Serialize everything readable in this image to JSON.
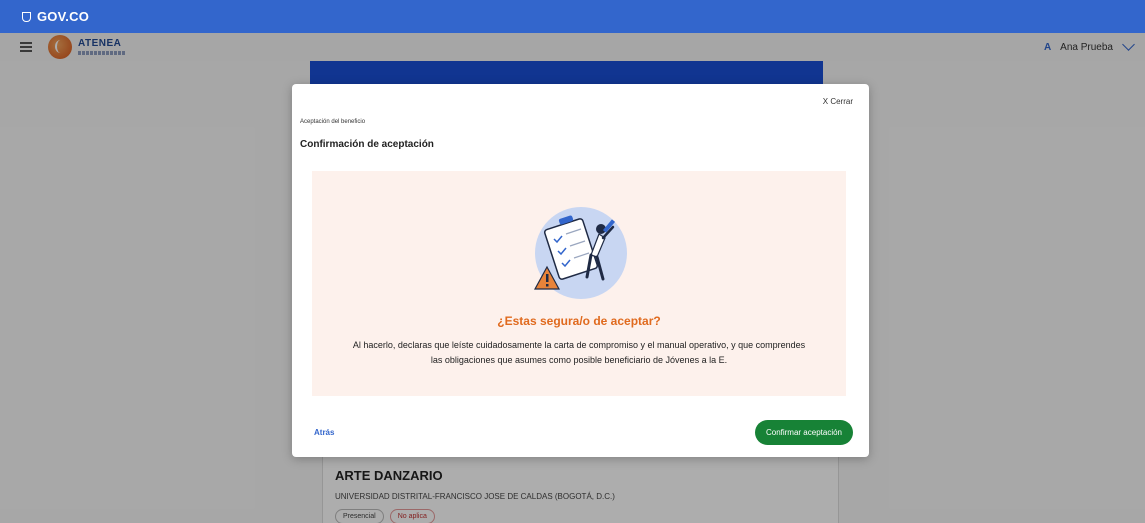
{
  "gov_bar": {
    "logo_text": "GOV.CO"
  },
  "header": {
    "app_name": "ATENEA",
    "user": {
      "initial": "A",
      "name": "Ana Prueba"
    }
  },
  "background": {
    "program": {
      "title": "ARTE DANZARIO",
      "university": "UNIVERSIDAD DISTRITAL-FRANCISCO JOSE DE CALDAS (BOGOTÁ, D.C.)",
      "chips": [
        "Presencial",
        "No aplica"
      ]
    }
  },
  "modal": {
    "close_label": "X Cerrar",
    "breadcrumb": "Aceptación del beneficio",
    "title": "Confirmación de aceptación",
    "illustration": "checklist-warning-illustration",
    "question": "¿Estas segura/o de aceptar?",
    "description": "Al hacerlo, declaras que leíste cuidadosamente la carta de compromiso y el manual operativo, y que comprendes las obligaciones que asumes como posible beneficiario de Jóvenes a la E.",
    "back_label": "Atrás",
    "confirm_label": "Confirmar aceptación"
  },
  "colors": {
    "gov_blue": "#3366cc",
    "accent_orange": "#e06a1e",
    "confirm_green": "#178236",
    "panel_bg": "#fdf1ec"
  }
}
